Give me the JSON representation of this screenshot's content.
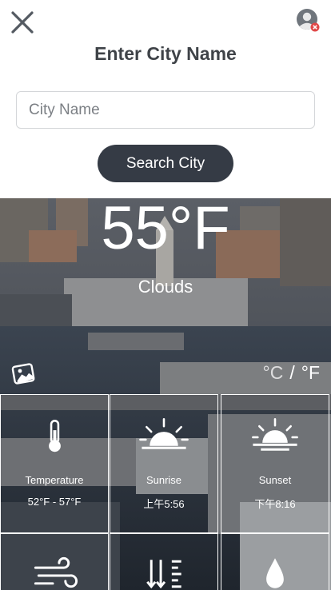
{
  "header": {
    "title": "Enter City Name",
    "close_icon": "close-icon",
    "avatar_icon": "user-avatar-icon"
  },
  "search": {
    "placeholder": "City Name",
    "value": "",
    "button_label": "Search City"
  },
  "weather": {
    "temperature": "55°F",
    "condition": "Clouds",
    "unit_c": "°C",
    "unit_sep": "/",
    "unit_f": "°F",
    "selected_unit": "°F",
    "background_icon": "change-photo-icon"
  },
  "tiles": [
    {
      "icon": "thermometer-icon",
      "label": "Temperature",
      "value": "52°F - 57°F"
    },
    {
      "icon": "sunrise-icon",
      "label": "Sunrise",
      "value": "上午5:56"
    },
    {
      "icon": "sunset-icon",
      "label": "Sunset",
      "value": "下午8:16"
    },
    {
      "icon": "wind-icon",
      "label": "",
      "value": ""
    },
    {
      "icon": "pressure-icon",
      "label": "",
      "value": ""
    },
    {
      "icon": "humidity-icon",
      "label": "",
      "value": ""
    }
  ],
  "colors": {
    "button_bg": "#353b45",
    "title_text": "#3f4348",
    "avatar_badge": "#e04848"
  }
}
